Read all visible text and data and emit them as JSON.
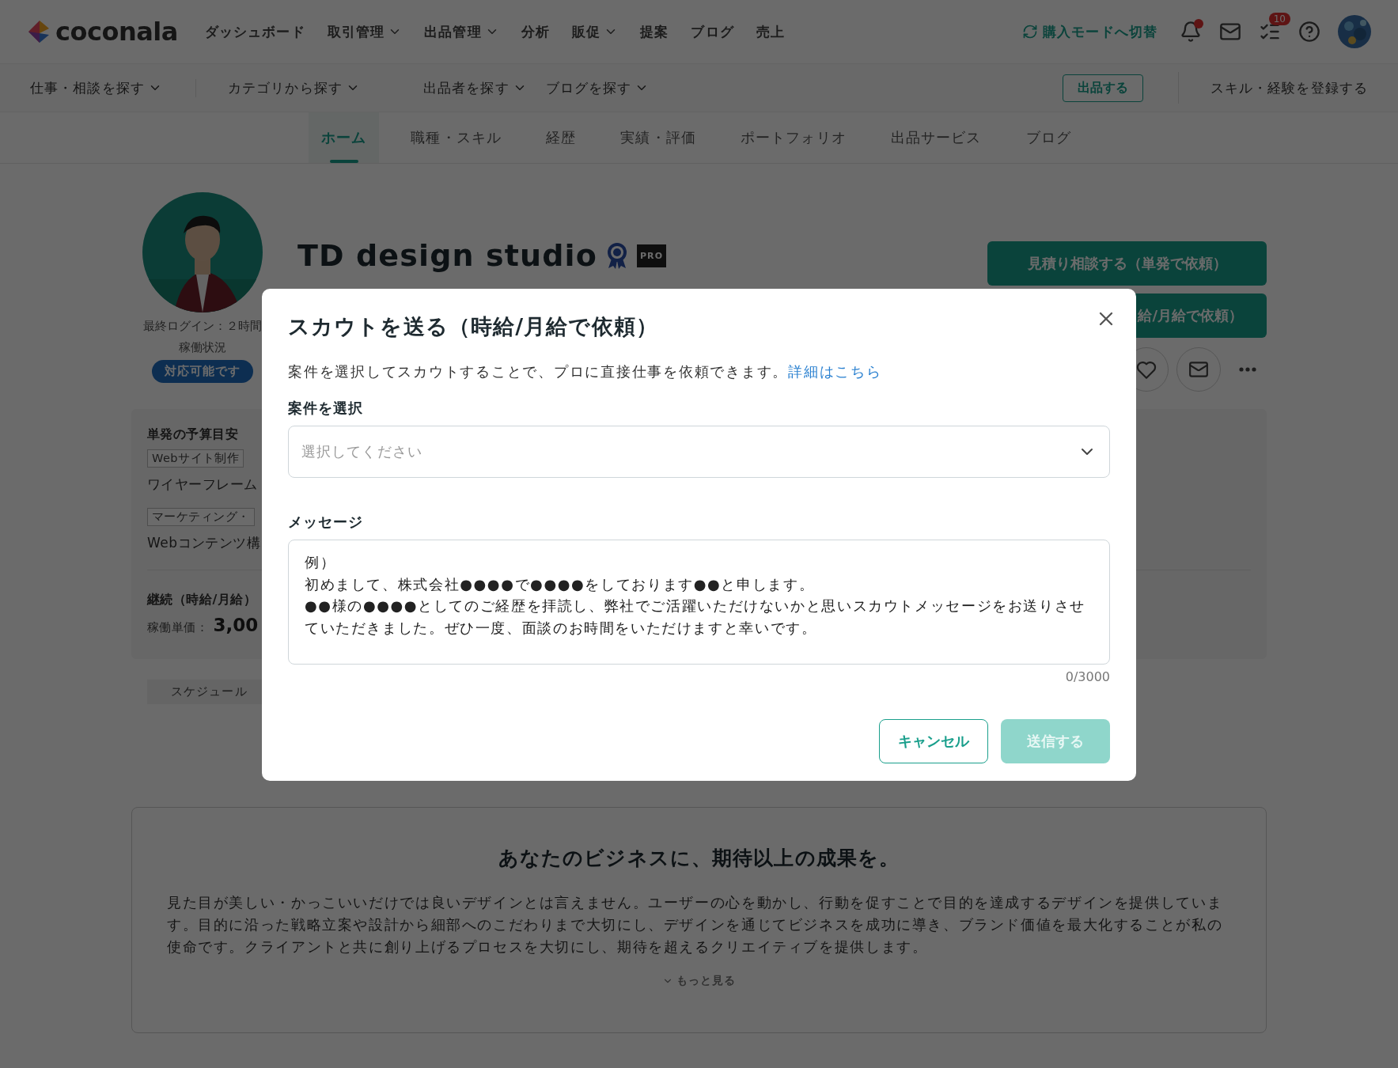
{
  "header": {
    "logo": "coconala",
    "nav": [
      {
        "label": "ダッシュボード",
        "dropdown": false
      },
      {
        "label": "取引管理",
        "dropdown": true
      },
      {
        "label": "出品管理",
        "dropdown": true
      },
      {
        "label": "分析",
        "dropdown": false
      },
      {
        "label": "販促",
        "dropdown": true
      },
      {
        "label": "提案",
        "dropdown": false
      },
      {
        "label": "ブログ",
        "dropdown": false
      },
      {
        "label": "売上",
        "dropdown": false
      }
    ],
    "mode_switch": "購入モードへ切替",
    "bell_unread": true,
    "task_badge": "10"
  },
  "subnav": {
    "items": [
      "仕事・相談を探す",
      "カテゴリから探す",
      "出品者を探す",
      "ブログを探す"
    ],
    "sell_button": "出品する",
    "register_link": "スキル・経験を登録する"
  },
  "tabs": [
    {
      "label": "ホーム",
      "selected": true
    },
    {
      "label": "職種・スキル",
      "selected": false
    },
    {
      "label": "経歴",
      "selected": false
    },
    {
      "label": "実績・評価",
      "selected": false
    },
    {
      "label": "ポートフォリオ",
      "selected": false
    },
    {
      "label": "出品サービス",
      "selected": false
    },
    {
      "label": "ブログ",
      "selected": false
    }
  ],
  "profile": {
    "name": "TD design studio",
    "badge": "PRO",
    "last_login": "最終ログイン：２時間",
    "status_label": "稼働状況",
    "status": "対応可能です",
    "buttons": [
      "見積り相談する（単発で依頼）",
      "給/月給で依頼）"
    ]
  },
  "budget": {
    "single_title": "単発の予算目安",
    "items": [
      {
        "tag": "Webサイト制作",
        "text": "ワイヤーフレーム"
      },
      {
        "tag": "マーケティング・",
        "text": "Webコンテンツ構"
      }
    ],
    "continuous_title": "継続（時給/月給）",
    "rate_label": "稼働単価：",
    "rate": "3,00"
  },
  "schedule_tab": "スケジュール",
  "intro": {
    "title": "あなたのビジネスに、期待以上の成果を。",
    "body": "見た目が美しい・かっこいいだけでは良いデザインとは言えません。ユーザーの心を動かし、行動を促すことで目的を達成するデザインを提供しています。目的に沿った戦略立案や設計から細部へのこだわりまで大切にし、デザインを通じてビジネスを成功に導き、ブランド価値を最大化することが私の使命です。クライアントと共に創り上げるプロセスを大切にし、期待を超えるクリエイティブを提供します。",
    "more": "もっと見る"
  },
  "modal": {
    "title": "スカウトを送る（時給/月給で依頼）",
    "description": "案件を選択してスカウトすることで、プロに直接仕事を依頼できます。",
    "link": "詳細はこちら",
    "select_label": "案件を選択",
    "select_placeholder": "選択してください",
    "message_label": "メッセージ",
    "message_placeholder": [
      "例）",
      "初めまして、株式会社●●●●で●●●●をしております●●と申します。",
      "●●様の●●●●としてのご経歴を拝読し、弊社でご活躍いただけないかと思いスカウトメッセージをお送りさせていただきました。ぜひ一度、面談のお時間をいただけますと幸いです。"
    ],
    "counter": "0/3000",
    "cancel": "キャンセル",
    "submit": {
      "label": "送信する",
      "disabled": true
    }
  }
}
